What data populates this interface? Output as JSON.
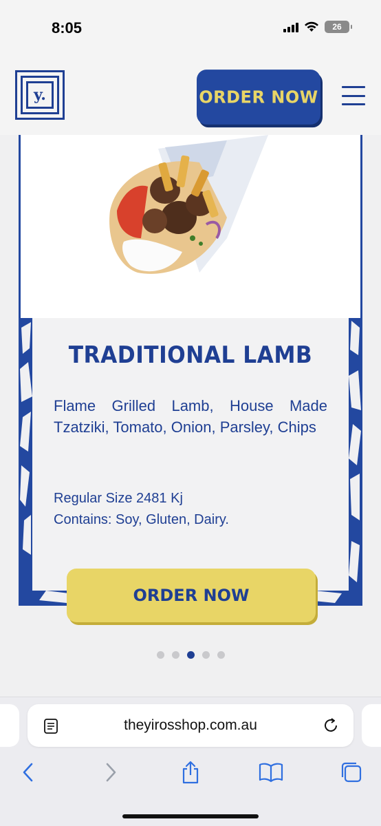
{
  "status_bar": {
    "time": "8:05",
    "battery": "26",
    "icons": [
      "signal-icon",
      "wifi-icon",
      "battery-icon"
    ]
  },
  "header": {
    "logo_text": "y.",
    "order_button": "ORDER NOW",
    "menu_icon": "hamburger-menu-icon"
  },
  "product": {
    "image": "lamb-gyro-wrap",
    "title": "TRADITIONAL LAMB",
    "description": "Flame Grilled Lamb, House Made Tzatziki, Tomato, Onion, Parsley, Chips",
    "size": "Regular Size 2481 Kj",
    "contains": "Contains: Soy, Gluten, Dairy.",
    "order_button": "ORDER NOW"
  },
  "carousel": {
    "total": 5,
    "active_index": 2
  },
  "browser": {
    "url": "theyirosshop.com.au",
    "toolbar": [
      "back-icon",
      "forward-icon",
      "share-icon",
      "bookmarks-icon",
      "tabs-icon"
    ]
  },
  "colors": {
    "brand_blue": "#2348a0",
    "brand_yellow": "#e8d566",
    "text_blue": "#1f3f93"
  }
}
